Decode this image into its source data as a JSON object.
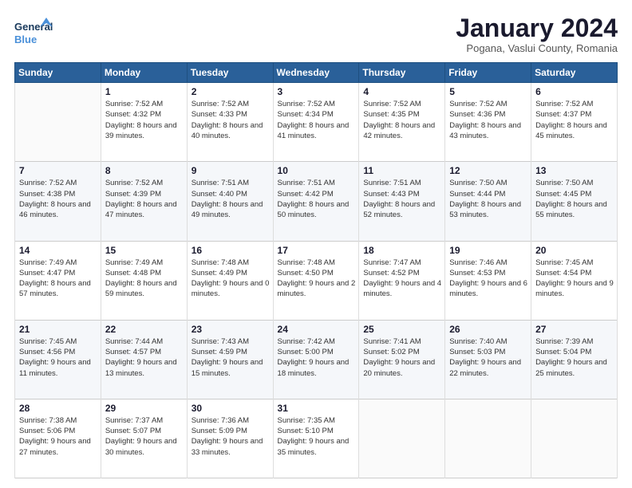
{
  "header": {
    "logo_line1": "General",
    "logo_line2": "Blue",
    "month": "January 2024",
    "location": "Pogana, Vaslui County, Romania"
  },
  "weekdays": [
    "Sunday",
    "Monday",
    "Tuesday",
    "Wednesday",
    "Thursday",
    "Friday",
    "Saturday"
  ],
  "weeks": [
    [
      {
        "day": "",
        "sunrise": "",
        "sunset": "",
        "daylight": ""
      },
      {
        "day": "1",
        "sunrise": "Sunrise: 7:52 AM",
        "sunset": "Sunset: 4:32 PM",
        "daylight": "Daylight: 8 hours and 39 minutes."
      },
      {
        "day": "2",
        "sunrise": "Sunrise: 7:52 AM",
        "sunset": "Sunset: 4:33 PM",
        "daylight": "Daylight: 8 hours and 40 minutes."
      },
      {
        "day": "3",
        "sunrise": "Sunrise: 7:52 AM",
        "sunset": "Sunset: 4:34 PM",
        "daylight": "Daylight: 8 hours and 41 minutes."
      },
      {
        "day": "4",
        "sunrise": "Sunrise: 7:52 AM",
        "sunset": "Sunset: 4:35 PM",
        "daylight": "Daylight: 8 hours and 42 minutes."
      },
      {
        "day": "5",
        "sunrise": "Sunrise: 7:52 AM",
        "sunset": "Sunset: 4:36 PM",
        "daylight": "Daylight: 8 hours and 43 minutes."
      },
      {
        "day": "6",
        "sunrise": "Sunrise: 7:52 AM",
        "sunset": "Sunset: 4:37 PM",
        "daylight": "Daylight: 8 hours and 45 minutes."
      }
    ],
    [
      {
        "day": "7",
        "sunrise": "Sunrise: 7:52 AM",
        "sunset": "Sunset: 4:38 PM",
        "daylight": "Daylight: 8 hours and 46 minutes."
      },
      {
        "day": "8",
        "sunrise": "Sunrise: 7:52 AM",
        "sunset": "Sunset: 4:39 PM",
        "daylight": "Daylight: 8 hours and 47 minutes."
      },
      {
        "day": "9",
        "sunrise": "Sunrise: 7:51 AM",
        "sunset": "Sunset: 4:40 PM",
        "daylight": "Daylight: 8 hours and 49 minutes."
      },
      {
        "day": "10",
        "sunrise": "Sunrise: 7:51 AM",
        "sunset": "Sunset: 4:42 PM",
        "daylight": "Daylight: 8 hours and 50 minutes."
      },
      {
        "day": "11",
        "sunrise": "Sunrise: 7:51 AM",
        "sunset": "Sunset: 4:43 PM",
        "daylight": "Daylight: 8 hours and 52 minutes."
      },
      {
        "day": "12",
        "sunrise": "Sunrise: 7:50 AM",
        "sunset": "Sunset: 4:44 PM",
        "daylight": "Daylight: 8 hours and 53 minutes."
      },
      {
        "day": "13",
        "sunrise": "Sunrise: 7:50 AM",
        "sunset": "Sunset: 4:45 PM",
        "daylight": "Daylight: 8 hours and 55 minutes."
      }
    ],
    [
      {
        "day": "14",
        "sunrise": "Sunrise: 7:49 AM",
        "sunset": "Sunset: 4:47 PM",
        "daylight": "Daylight: 8 hours and 57 minutes."
      },
      {
        "day": "15",
        "sunrise": "Sunrise: 7:49 AM",
        "sunset": "Sunset: 4:48 PM",
        "daylight": "Daylight: 8 hours and 59 minutes."
      },
      {
        "day": "16",
        "sunrise": "Sunrise: 7:48 AM",
        "sunset": "Sunset: 4:49 PM",
        "daylight": "Daylight: 9 hours and 0 minutes."
      },
      {
        "day": "17",
        "sunrise": "Sunrise: 7:48 AM",
        "sunset": "Sunset: 4:50 PM",
        "daylight": "Daylight: 9 hours and 2 minutes."
      },
      {
        "day": "18",
        "sunrise": "Sunrise: 7:47 AM",
        "sunset": "Sunset: 4:52 PM",
        "daylight": "Daylight: 9 hours and 4 minutes."
      },
      {
        "day": "19",
        "sunrise": "Sunrise: 7:46 AM",
        "sunset": "Sunset: 4:53 PM",
        "daylight": "Daylight: 9 hours and 6 minutes."
      },
      {
        "day": "20",
        "sunrise": "Sunrise: 7:45 AM",
        "sunset": "Sunset: 4:54 PM",
        "daylight": "Daylight: 9 hours and 9 minutes."
      }
    ],
    [
      {
        "day": "21",
        "sunrise": "Sunrise: 7:45 AM",
        "sunset": "Sunset: 4:56 PM",
        "daylight": "Daylight: 9 hours and 11 minutes."
      },
      {
        "day": "22",
        "sunrise": "Sunrise: 7:44 AM",
        "sunset": "Sunset: 4:57 PM",
        "daylight": "Daylight: 9 hours and 13 minutes."
      },
      {
        "day": "23",
        "sunrise": "Sunrise: 7:43 AM",
        "sunset": "Sunset: 4:59 PM",
        "daylight": "Daylight: 9 hours and 15 minutes."
      },
      {
        "day": "24",
        "sunrise": "Sunrise: 7:42 AM",
        "sunset": "Sunset: 5:00 PM",
        "daylight": "Daylight: 9 hours and 18 minutes."
      },
      {
        "day": "25",
        "sunrise": "Sunrise: 7:41 AM",
        "sunset": "Sunset: 5:02 PM",
        "daylight": "Daylight: 9 hours and 20 minutes."
      },
      {
        "day": "26",
        "sunrise": "Sunrise: 7:40 AM",
        "sunset": "Sunset: 5:03 PM",
        "daylight": "Daylight: 9 hours and 22 minutes."
      },
      {
        "day": "27",
        "sunrise": "Sunrise: 7:39 AM",
        "sunset": "Sunset: 5:04 PM",
        "daylight": "Daylight: 9 hours and 25 minutes."
      }
    ],
    [
      {
        "day": "28",
        "sunrise": "Sunrise: 7:38 AM",
        "sunset": "Sunset: 5:06 PM",
        "daylight": "Daylight: 9 hours and 27 minutes."
      },
      {
        "day": "29",
        "sunrise": "Sunrise: 7:37 AM",
        "sunset": "Sunset: 5:07 PM",
        "daylight": "Daylight: 9 hours and 30 minutes."
      },
      {
        "day": "30",
        "sunrise": "Sunrise: 7:36 AM",
        "sunset": "Sunset: 5:09 PM",
        "daylight": "Daylight: 9 hours and 33 minutes."
      },
      {
        "day": "31",
        "sunrise": "Sunrise: 7:35 AM",
        "sunset": "Sunset: 5:10 PM",
        "daylight": "Daylight: 9 hours and 35 minutes."
      },
      {
        "day": "",
        "sunrise": "",
        "sunset": "",
        "daylight": ""
      },
      {
        "day": "",
        "sunrise": "",
        "sunset": "",
        "daylight": ""
      },
      {
        "day": "",
        "sunrise": "",
        "sunset": "",
        "daylight": ""
      }
    ]
  ]
}
